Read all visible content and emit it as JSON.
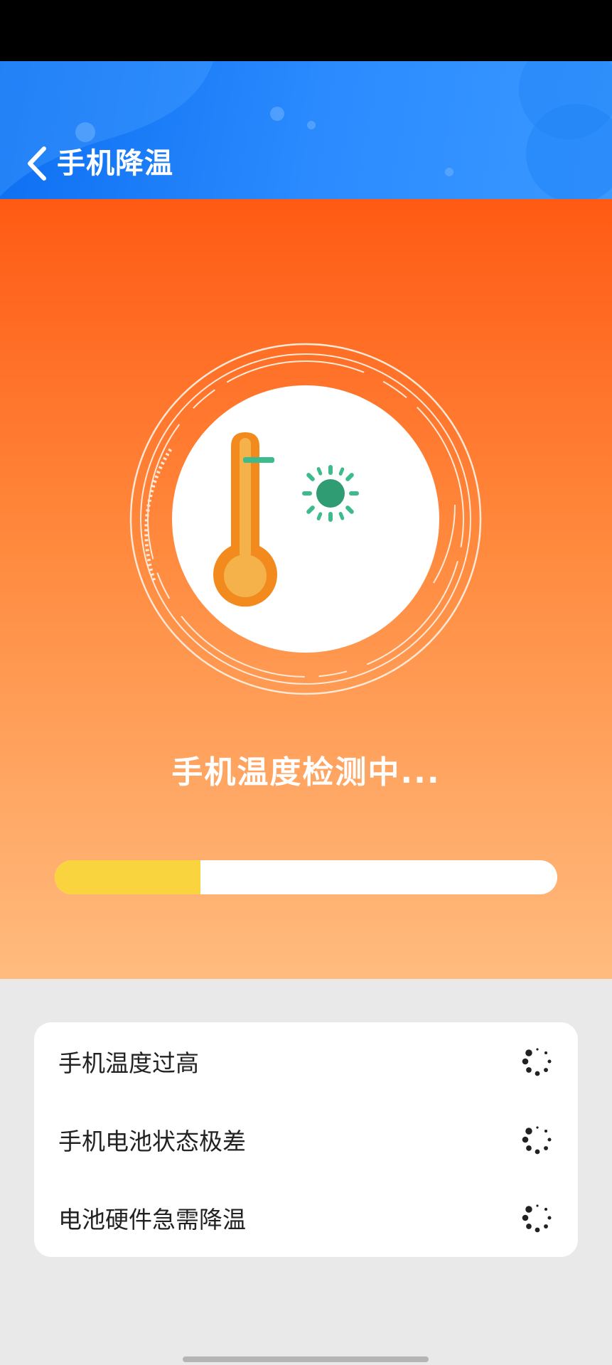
{
  "header": {
    "title": "手机降温",
    "back_icon": "chevron-left-icon"
  },
  "hero": {
    "icon": "thermometer-sun-icon",
    "status_text": "手机温度检测中...",
    "progress": 0.29
  },
  "checks": [
    {
      "label": "手机温度过高",
      "state_icon": "loading-spinner-icon"
    },
    {
      "label": "手机电池状态极差",
      "state_icon": "loading-spinner-icon"
    },
    {
      "label": "电池硬件急需降温",
      "state_icon": "loading-spinner-icon"
    }
  ],
  "colors": {
    "header_blue": "#2c8cff",
    "hero_orange_top": "#ff5a14",
    "hero_orange_bottom": "#ffbb7e",
    "progress_fill": "#f9d43f",
    "thermometer_orange": "#f28a1e",
    "sun_green": "#2f9c73"
  }
}
